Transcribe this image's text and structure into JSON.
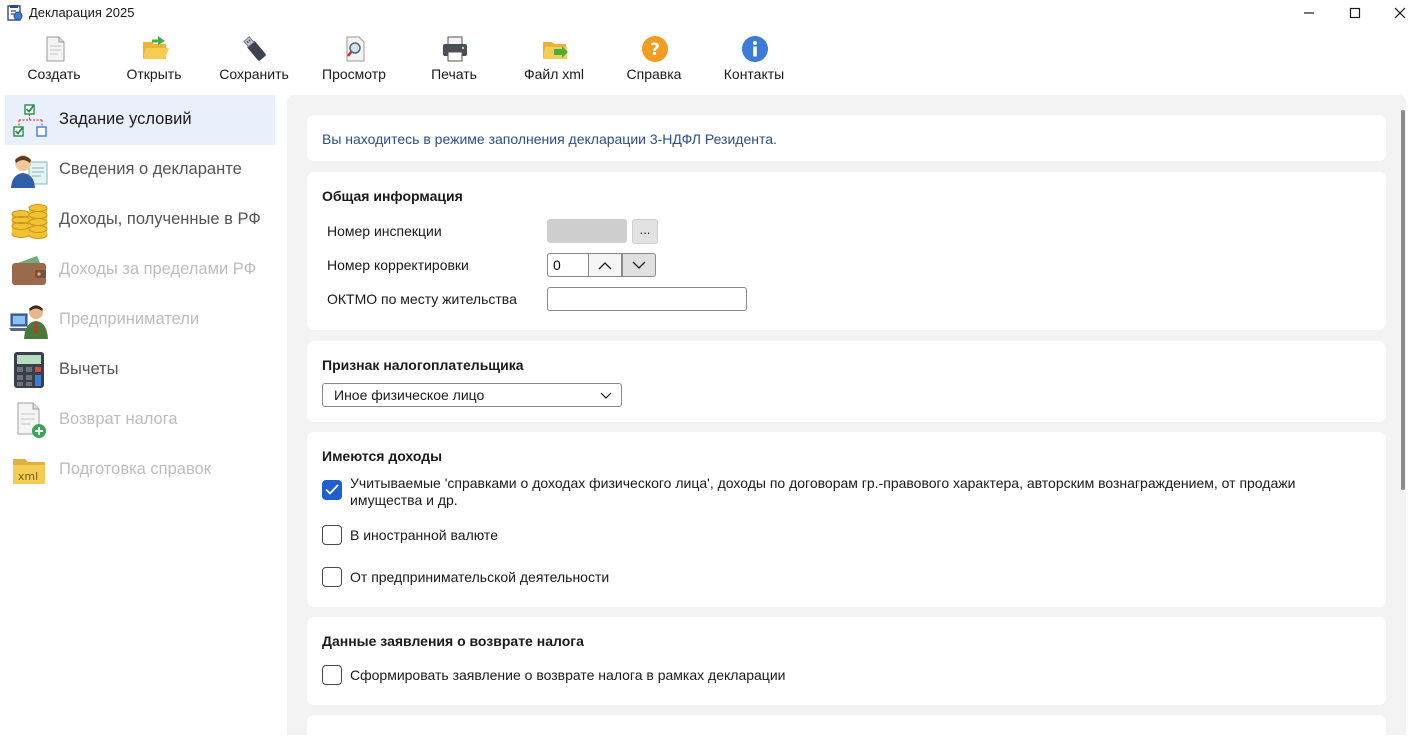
{
  "window": {
    "title": "Декларация 2025"
  },
  "toolbar": {
    "items": [
      {
        "label": "Создать",
        "icon": "new-document-icon"
      },
      {
        "label": "Открыть",
        "icon": "open-folder-icon"
      },
      {
        "label": "Сохранить",
        "icon": "save-usb-icon"
      },
      {
        "label": "Просмотр",
        "icon": "preview-magnifier-icon"
      },
      {
        "label": "Печать",
        "icon": "printer-icon"
      },
      {
        "label": "Файл xml",
        "icon": "xml-folder-icon"
      },
      {
        "label": "Справка",
        "icon": "help-icon"
      },
      {
        "label": "Контакты",
        "icon": "info-icon"
      }
    ]
  },
  "sidebar": {
    "items": [
      {
        "label": "Задание условий",
        "state": "active"
      },
      {
        "label": "Сведения о декларанте",
        "state": "normal"
      },
      {
        "label": "Доходы, полученные в РФ",
        "state": "normal"
      },
      {
        "label": "Доходы за пределами РФ",
        "state": "disabled"
      },
      {
        "label": "Предприниматели",
        "state": "disabled"
      },
      {
        "label": "Вычеты",
        "state": "normal"
      },
      {
        "label": "Возврат налога",
        "state": "disabled"
      },
      {
        "label": "Подготовка справок",
        "state": "disabled"
      }
    ]
  },
  "main": {
    "mode_text": "Вы находитесь в режиме заполнения декларации 3-НДФЛ Резидента.",
    "general": {
      "title": "Общая информация",
      "inspection_label": "Номер инспекции",
      "inspection_value": "",
      "dots_label": "...",
      "correction_label": "Номер корректировки",
      "correction_value": "0",
      "oktmo_label": "ОКТМО по месту жительства",
      "oktmo_value": ""
    },
    "taxpayer": {
      "title": "Признак налогоплательщика",
      "selected": "Иное физическое лицо"
    },
    "income": {
      "title": "Имеются доходы",
      "items": [
        {
          "label": "Учитываемые 'справками о доходах физического лица', доходы по договорам гр.-правового характера, авторским вознаграждением, от продажи имущества и др.",
          "checked": true
        },
        {
          "label": "В иностранной валюте",
          "checked": false
        },
        {
          "label": "От предпринимательской деятельности",
          "checked": false
        }
      ]
    },
    "refund": {
      "title": "Данные заявления о возврате налога",
      "item": {
        "label": "Сформировать заявление о возврате налога в рамках декларации",
        "checked": false
      }
    }
  },
  "colors": {
    "accent": "#1f5fcf",
    "info_text": "#2c4f8c",
    "panel_bg": "#f3f3f3",
    "active_nav_bg": "#e9effb"
  }
}
